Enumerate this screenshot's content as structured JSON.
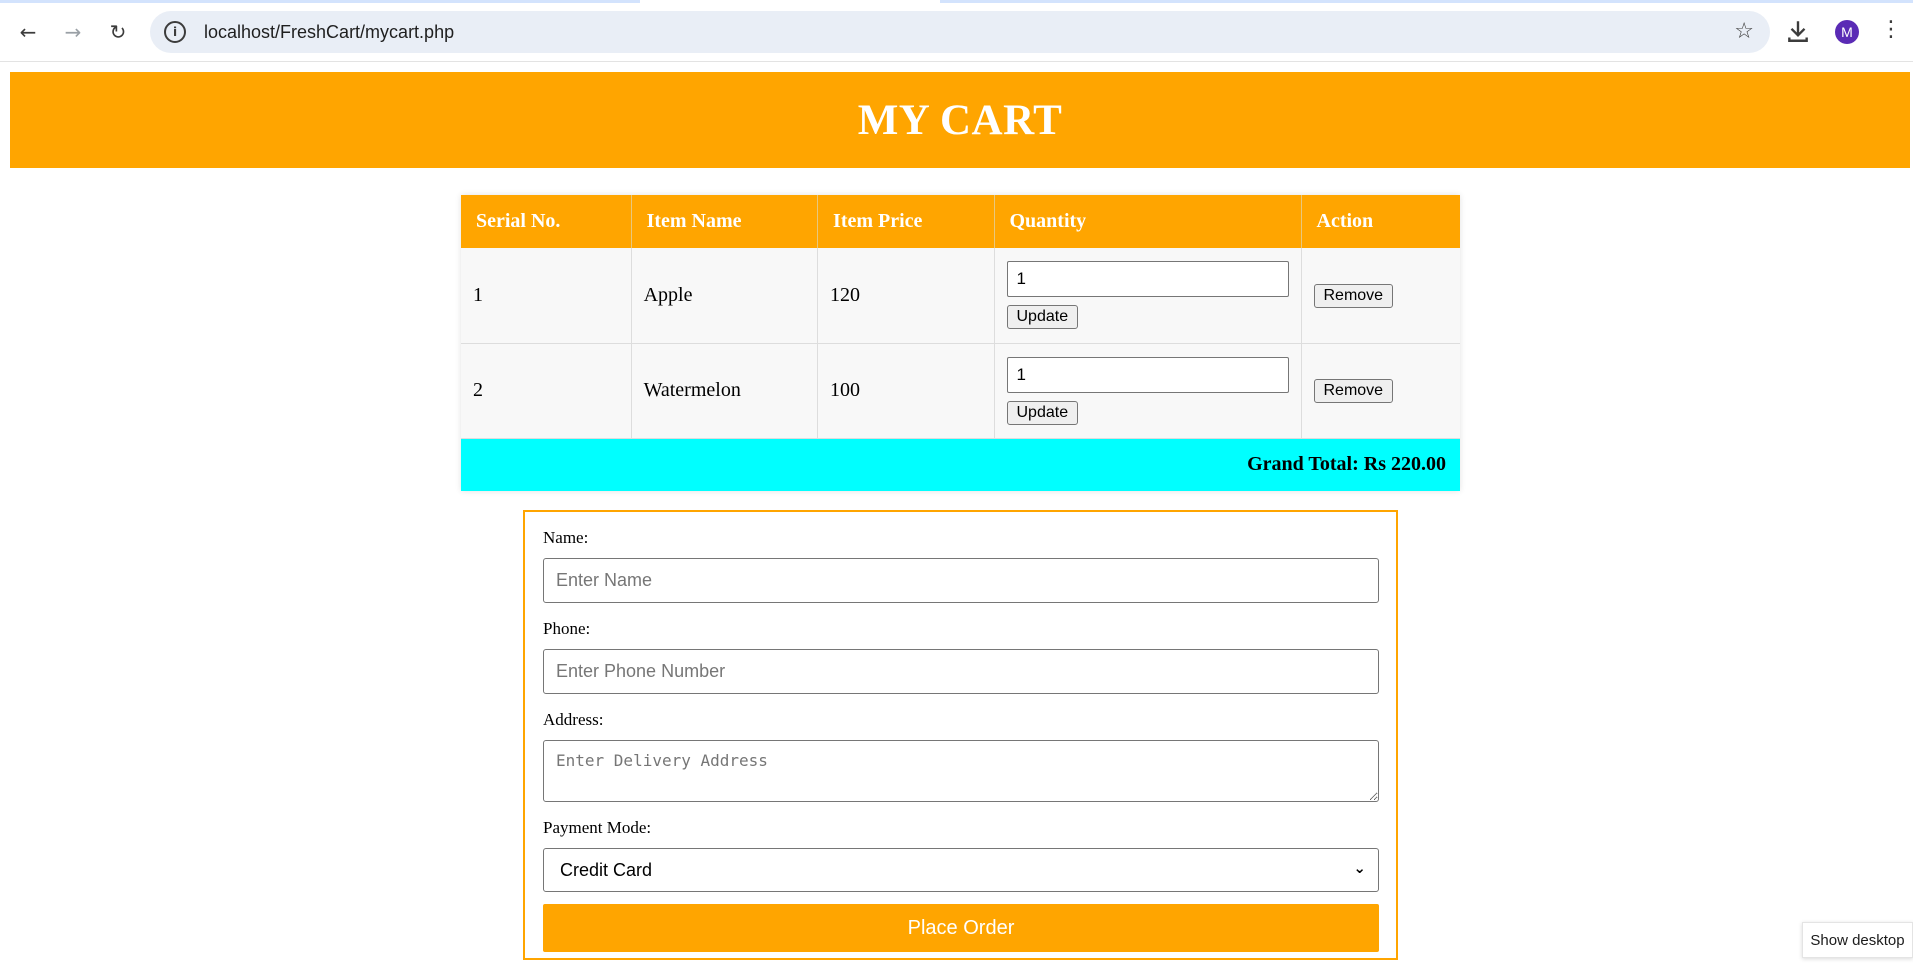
{
  "browser": {
    "url": "localhost/FreshCart/mycart.php",
    "avatar_letter": "M",
    "icons": [
      "back-arrow-icon",
      "forward-arrow-icon",
      "reload-icon",
      "site-info-icon",
      "bookmark-star-icon",
      "download-icon",
      "kebab-menu-icon"
    ]
  },
  "page": {
    "title": "MY CART",
    "accent_color": "#ffa500",
    "total_bg_color": "#00ffff"
  },
  "cart": {
    "headers": [
      "Serial No.",
      "Item Name",
      "Item Price",
      "Quantity",
      "Action"
    ],
    "rows": [
      {
        "serial": "1",
        "name": "Apple",
        "price": "120",
        "quantity": "1",
        "update_label": "Update",
        "remove_label": "Remove"
      },
      {
        "serial": "2",
        "name": "Watermelon",
        "price": "100",
        "quantity": "1",
        "update_label": "Update",
        "remove_label": "Remove"
      }
    ],
    "grand_total": "Grand Total: Rs 220.00"
  },
  "order_form": {
    "name_label": "Name:",
    "name_placeholder": "Enter Name",
    "phone_label": "Phone:",
    "phone_placeholder": "Enter Phone Number",
    "address_label": "Address:",
    "address_placeholder": "Enter Delivery Address",
    "payment_label": "Payment Mode:",
    "payment_selected": "Credit Card",
    "submit_label": "Place Order"
  },
  "taskbar": {
    "show_desktop": "Show desktop"
  }
}
